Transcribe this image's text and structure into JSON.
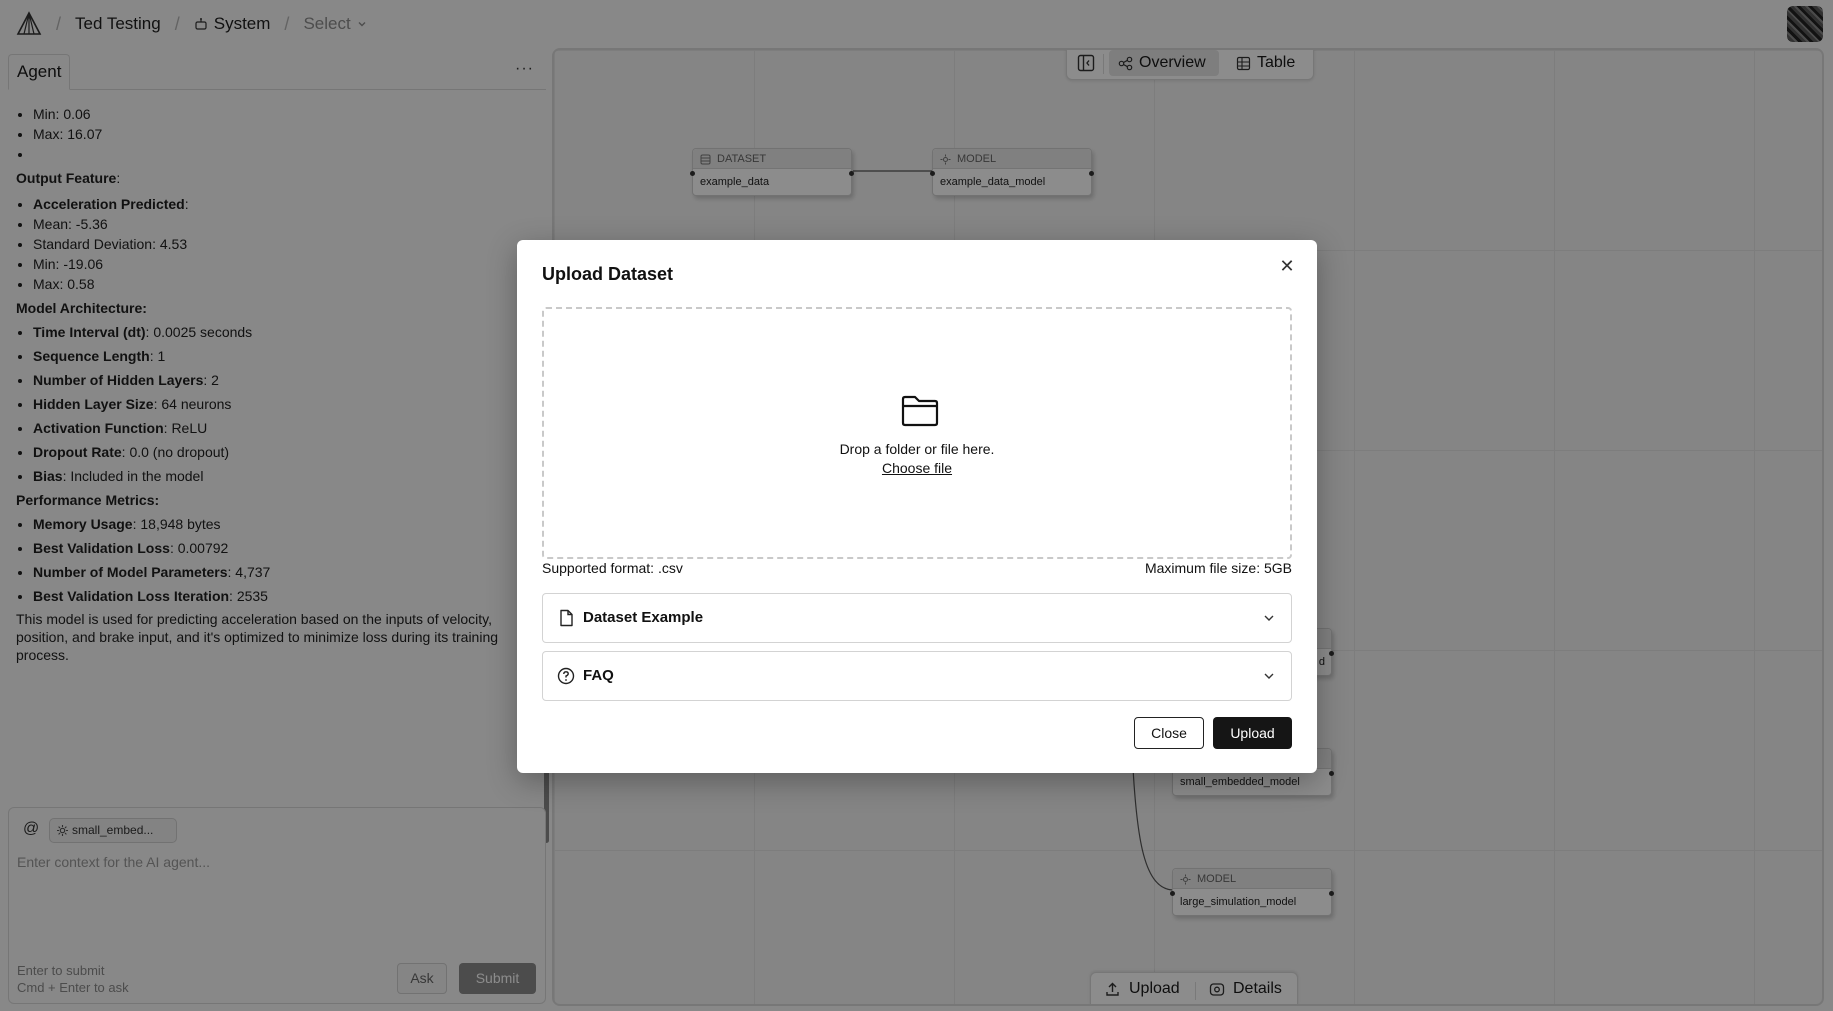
{
  "breadcrumb": {
    "project": "Ted Testing",
    "system": "System",
    "select": "Select"
  },
  "agent": {
    "tab_label": "Agent",
    "more_label": "···",
    "top_items": [
      "Min: 0.06",
      "Max: 16.07",
      ""
    ],
    "output_feature_heading": "Output Feature",
    "output_feature_name": "Acceleration Predicted",
    "output_items": [
      "Mean: -5.36",
      "Standard Deviation: 4.53",
      "Min: -19.06",
      "Max: 0.58"
    ],
    "architecture_heading": "Model Architecture:",
    "architecture": [
      {
        "label": "Time Interval (dt)",
        "value": ": 0.0025 seconds"
      },
      {
        "label": "Sequence Length",
        "value": ": 1"
      },
      {
        "label": "Number of Hidden Layers",
        "value": ": 2"
      },
      {
        "label": "Hidden Layer Size",
        "value": ": 64 neurons"
      },
      {
        "label": "Activation Function",
        "value": ": ReLU"
      },
      {
        "label": "Dropout Rate",
        "value": ": 0.0 (no dropout)"
      },
      {
        "label": "Bias",
        "value": ": Included in the model"
      }
    ],
    "metrics_heading": "Performance Metrics:",
    "metrics": [
      {
        "label": "Memory Usage",
        "value": ": 18,948 bytes"
      },
      {
        "label": "Best Validation Loss",
        "value": ": 0.00792"
      },
      {
        "label": "Number of Model Parameters",
        "value": ": 4,737"
      },
      {
        "label": "Best Validation Loss Iteration",
        "value": ": 2535"
      }
    ],
    "summary": "This model is used for predicting acceleration based on the inputs of velocity, position, and brake input, and it's optimized to minimize loss during its training process."
  },
  "composer": {
    "at_symbol": "@",
    "context_chip": "small_embed...",
    "placeholder": "Enter context for the AI agent...",
    "hint_line1": "Enter to submit",
    "hint_line2": "Cmd + Enter to ask",
    "ask_label": "Ask",
    "submit_label": "Submit"
  },
  "canvas": {
    "overview_label": "Overview",
    "table_label": "Table",
    "nodes": [
      {
        "type": "DATASET",
        "name": "example_data"
      },
      {
        "type": "MODEL",
        "name": "example_data_model"
      },
      {
        "type": "",
        "name": "d"
      },
      {
        "type": "",
        "name": "small_embedded_model"
      },
      {
        "type": "MODEL",
        "name": "large_simulation_model"
      }
    ],
    "bottom_upload_label": "Upload",
    "bottom_details_label": "Details"
  },
  "modal": {
    "title": "Upload Dataset",
    "drop_text": "Drop a folder or file here.",
    "choose_file": "Choose file",
    "supported_format": "Supported format: .csv",
    "max_size": "Maximum file size: 5GB",
    "accordion_dataset_example": "Dataset Example",
    "accordion_faq": "FAQ",
    "close_label": "Close",
    "upload_label": "Upload"
  }
}
